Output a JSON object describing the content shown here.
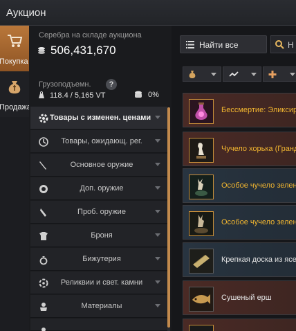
{
  "window": {
    "title": "Аукцион"
  },
  "rail": {
    "tabs": [
      {
        "label": "Покупка",
        "icon": "cart-icon",
        "active": true
      },
      {
        "label": "Продажа",
        "icon": "money-bag-icon",
        "active": false
      }
    ]
  },
  "wallet": {
    "caption": "Серебра на складе аукциона",
    "amount": "506,431,670",
    "weight_caption": "Грузоподъемн.",
    "help": "?",
    "weight_value": "118.4 / 5,165 VT",
    "percent": "0%"
  },
  "categories": [
    {
      "label": "Товары с изменен. ценами",
      "icon": "price-change-icon"
    },
    {
      "label": "Товары, ожидающ. рег.",
      "icon": "clock-icon"
    },
    {
      "label": "Основное оружие",
      "icon": "sword-icon"
    },
    {
      "label": "Доп. оружие",
      "icon": "shield-icon"
    },
    {
      "label": "Проб. оружие",
      "icon": "dagger-icon"
    },
    {
      "label": "Броня",
      "icon": "armor-icon"
    },
    {
      "label": "Бижутерия",
      "icon": "ring-icon"
    },
    {
      "label": "Реликвии и свет. камни",
      "icon": "relic-icon"
    },
    {
      "label": "Материалы",
      "icon": "materials-icon"
    }
  ],
  "toolbar": {
    "find_all": "Найти все",
    "search_placeholder": "Н"
  },
  "filters": [
    {
      "icon": "bag-icon"
    },
    {
      "icon": "trend-icon"
    },
    {
      "icon": "plus-icon"
    }
  ],
  "items": [
    {
      "name": "Бессмертие: Эликсир",
      "icon": "potion-icon",
      "rarity_color": "#f2b630"
    },
    {
      "name": "Чучело хорька (Грандис)",
      "icon": "ferret-figure-icon",
      "rarity_color": "#f2b630"
    },
    {
      "name": "Особое чучело зеленого",
      "icon": "deer-figure-icon",
      "rarity_color": "#f2b630"
    },
    {
      "name": "Особое чучело зеленого",
      "icon": "deer-figure-icon",
      "rarity_color": "#f2b630"
    },
    {
      "name": "Крепкая доска из ясеня",
      "icon": "plank-icon",
      "rarity_color": "#e4e4e4"
    },
    {
      "name": "Сушеный ерш",
      "icon": "dried-fish-icon",
      "rarity_color": "#e4e4e4"
    }
  ]
}
